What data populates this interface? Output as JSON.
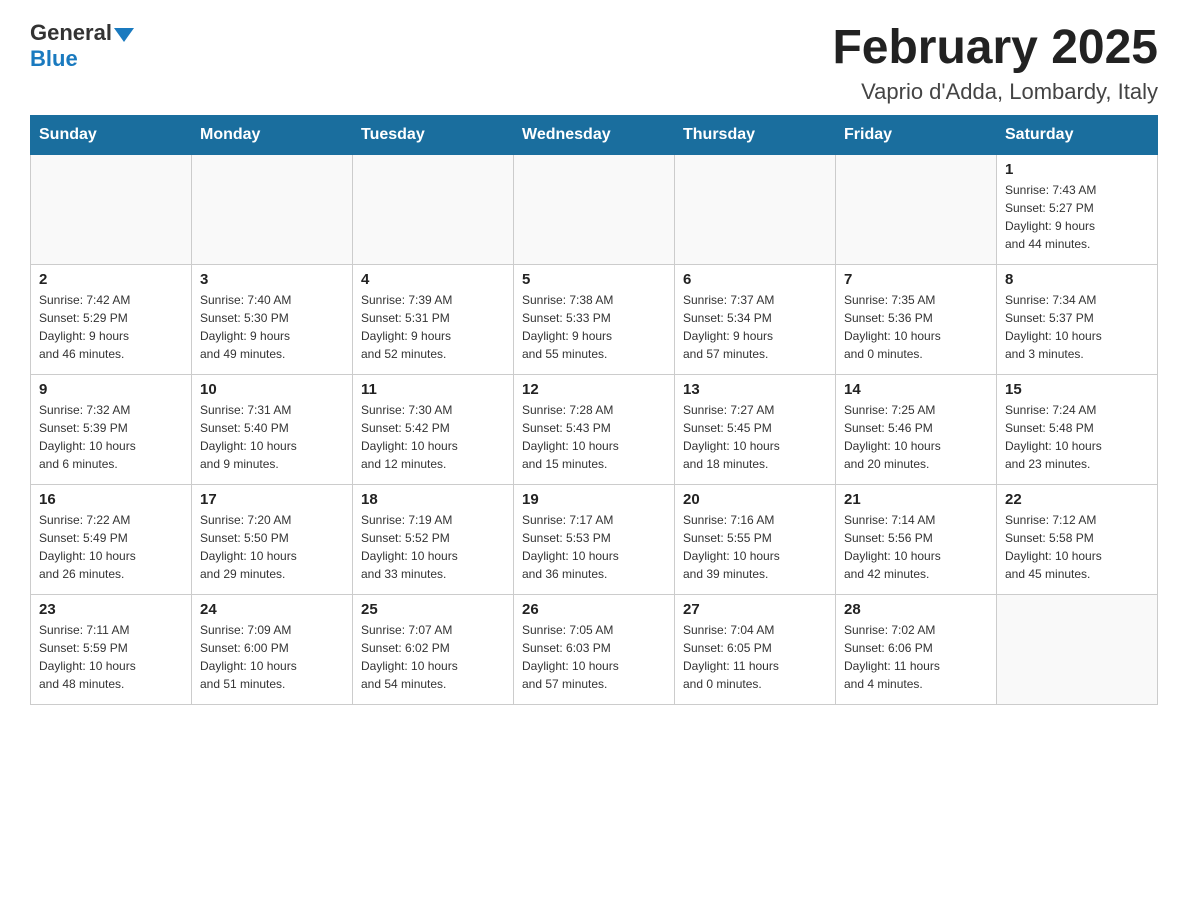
{
  "header": {
    "logo_general": "General",
    "logo_blue": "Blue",
    "month_title": "February 2025",
    "location": "Vaprio d'Adda, Lombardy, Italy"
  },
  "days_of_week": [
    "Sunday",
    "Monday",
    "Tuesday",
    "Wednesday",
    "Thursday",
    "Friday",
    "Saturday"
  ],
  "weeks": [
    [
      {
        "day": "",
        "info": ""
      },
      {
        "day": "",
        "info": ""
      },
      {
        "day": "",
        "info": ""
      },
      {
        "day": "",
        "info": ""
      },
      {
        "day": "",
        "info": ""
      },
      {
        "day": "",
        "info": ""
      },
      {
        "day": "1",
        "info": "Sunrise: 7:43 AM\nSunset: 5:27 PM\nDaylight: 9 hours\nand 44 minutes."
      }
    ],
    [
      {
        "day": "2",
        "info": "Sunrise: 7:42 AM\nSunset: 5:29 PM\nDaylight: 9 hours\nand 46 minutes."
      },
      {
        "day": "3",
        "info": "Sunrise: 7:40 AM\nSunset: 5:30 PM\nDaylight: 9 hours\nand 49 minutes."
      },
      {
        "day": "4",
        "info": "Sunrise: 7:39 AM\nSunset: 5:31 PM\nDaylight: 9 hours\nand 52 minutes."
      },
      {
        "day": "5",
        "info": "Sunrise: 7:38 AM\nSunset: 5:33 PM\nDaylight: 9 hours\nand 55 minutes."
      },
      {
        "day": "6",
        "info": "Sunrise: 7:37 AM\nSunset: 5:34 PM\nDaylight: 9 hours\nand 57 minutes."
      },
      {
        "day": "7",
        "info": "Sunrise: 7:35 AM\nSunset: 5:36 PM\nDaylight: 10 hours\nand 0 minutes."
      },
      {
        "day": "8",
        "info": "Sunrise: 7:34 AM\nSunset: 5:37 PM\nDaylight: 10 hours\nand 3 minutes."
      }
    ],
    [
      {
        "day": "9",
        "info": "Sunrise: 7:32 AM\nSunset: 5:39 PM\nDaylight: 10 hours\nand 6 minutes."
      },
      {
        "day": "10",
        "info": "Sunrise: 7:31 AM\nSunset: 5:40 PM\nDaylight: 10 hours\nand 9 minutes."
      },
      {
        "day": "11",
        "info": "Sunrise: 7:30 AM\nSunset: 5:42 PM\nDaylight: 10 hours\nand 12 minutes."
      },
      {
        "day": "12",
        "info": "Sunrise: 7:28 AM\nSunset: 5:43 PM\nDaylight: 10 hours\nand 15 minutes."
      },
      {
        "day": "13",
        "info": "Sunrise: 7:27 AM\nSunset: 5:45 PM\nDaylight: 10 hours\nand 18 minutes."
      },
      {
        "day": "14",
        "info": "Sunrise: 7:25 AM\nSunset: 5:46 PM\nDaylight: 10 hours\nand 20 minutes."
      },
      {
        "day": "15",
        "info": "Sunrise: 7:24 AM\nSunset: 5:48 PM\nDaylight: 10 hours\nand 23 minutes."
      }
    ],
    [
      {
        "day": "16",
        "info": "Sunrise: 7:22 AM\nSunset: 5:49 PM\nDaylight: 10 hours\nand 26 minutes."
      },
      {
        "day": "17",
        "info": "Sunrise: 7:20 AM\nSunset: 5:50 PM\nDaylight: 10 hours\nand 29 minutes."
      },
      {
        "day": "18",
        "info": "Sunrise: 7:19 AM\nSunset: 5:52 PM\nDaylight: 10 hours\nand 33 minutes."
      },
      {
        "day": "19",
        "info": "Sunrise: 7:17 AM\nSunset: 5:53 PM\nDaylight: 10 hours\nand 36 minutes."
      },
      {
        "day": "20",
        "info": "Sunrise: 7:16 AM\nSunset: 5:55 PM\nDaylight: 10 hours\nand 39 minutes."
      },
      {
        "day": "21",
        "info": "Sunrise: 7:14 AM\nSunset: 5:56 PM\nDaylight: 10 hours\nand 42 minutes."
      },
      {
        "day": "22",
        "info": "Sunrise: 7:12 AM\nSunset: 5:58 PM\nDaylight: 10 hours\nand 45 minutes."
      }
    ],
    [
      {
        "day": "23",
        "info": "Sunrise: 7:11 AM\nSunset: 5:59 PM\nDaylight: 10 hours\nand 48 minutes."
      },
      {
        "day": "24",
        "info": "Sunrise: 7:09 AM\nSunset: 6:00 PM\nDaylight: 10 hours\nand 51 minutes."
      },
      {
        "day": "25",
        "info": "Sunrise: 7:07 AM\nSunset: 6:02 PM\nDaylight: 10 hours\nand 54 minutes."
      },
      {
        "day": "26",
        "info": "Sunrise: 7:05 AM\nSunset: 6:03 PM\nDaylight: 10 hours\nand 57 minutes."
      },
      {
        "day": "27",
        "info": "Sunrise: 7:04 AM\nSunset: 6:05 PM\nDaylight: 11 hours\nand 0 minutes."
      },
      {
        "day": "28",
        "info": "Sunrise: 7:02 AM\nSunset: 6:06 PM\nDaylight: 11 hours\nand 4 minutes."
      },
      {
        "day": "",
        "info": ""
      }
    ]
  ]
}
